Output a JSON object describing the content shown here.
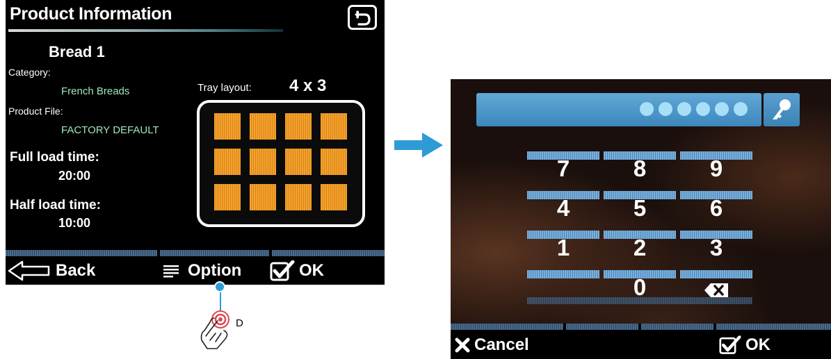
{
  "left_screen": {
    "title": "Product Information",
    "product_name": "Bread 1",
    "category_label": "Category:",
    "category_value": "French Breads",
    "product_file_label": "Product File:",
    "product_file_value": "FACTORY DEFAULT",
    "full_load_label": "Full load time:",
    "full_load_value": "20:00",
    "half_load_label": "Half load time:",
    "half_load_value": "10:00",
    "tray_label": "Tray layout:",
    "tray_value": "4 x 3",
    "buttons": {
      "back": "Back",
      "option": "Option",
      "ok": "OK"
    }
  },
  "callout": {
    "letter": "D"
  },
  "right_screen": {
    "pin_entered_count": 6,
    "keypad": [
      [
        "7",
        "8",
        "9"
      ],
      [
        "4",
        "5",
        "6"
      ],
      [
        "1",
        "2",
        "3"
      ],
      [
        "",
        "0",
        ""
      ]
    ],
    "buttons": {
      "cancel": "Cancel",
      "ok": "OK"
    }
  },
  "colors": {
    "accent_blue": "#2e9bd6",
    "value_green": "#9fe8b8",
    "tray_orange": "#f3a22c",
    "pin_field_blue": "#4a95c8"
  },
  "icons": [
    "return-icon",
    "back-arrow-icon",
    "menu-lines-icon",
    "checkbox-check-icon",
    "finger-tap-icon",
    "arrow-right-icon",
    "key-icon",
    "backspace-x-icon",
    "x-icon"
  ]
}
